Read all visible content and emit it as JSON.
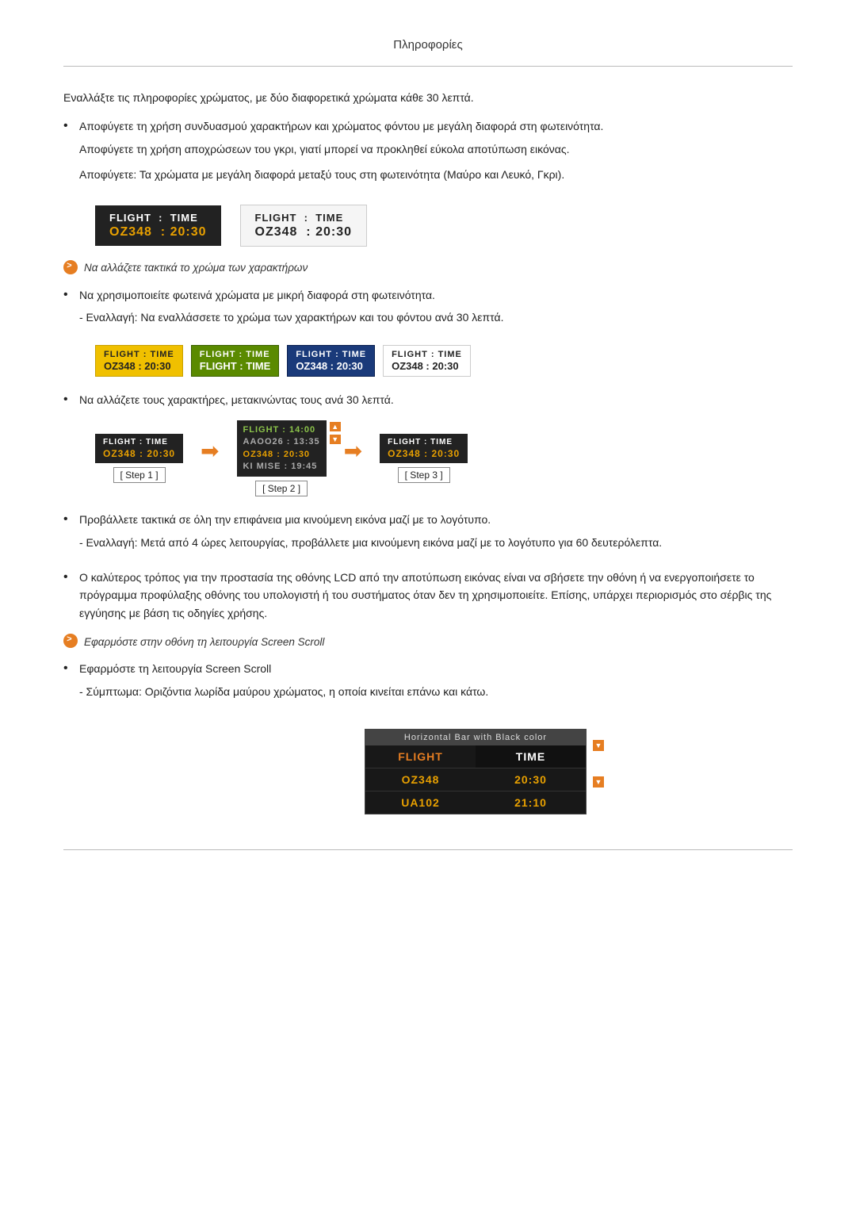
{
  "page": {
    "title": "Πληροφορίες",
    "intro": "Εναλλάξτε τις πληροφορίες χρώματος, με δύο διαφορετικά χρώματα κάθε 30 λεπτά.",
    "bullet1": {
      "text": "Αποφύγετε τη χρήση συνδυασμού χαρακτήρων και χρώματος φόντου με μεγάλη διαφορά στη φωτεινότητα.",
      "sub1": "Αποφύγετε τη χρήση αποχρώσεων του γκρι, γιατί μπορεί να προκληθεί εύκολα αποτύπωση εικόνας.",
      "sub2": "Αποφύγετε: Τα χρώματα με μεγάλη διαφορά μεταξύ τους στη φωτεινότητα (Μαύρο και Λευκό, Γκρι)."
    },
    "note1": "Να αλλάζετε τακτικά το χρώμα των χαρακτήρων",
    "bullet2": {
      "text": "Να χρησιμοποιείτε φωτεινά χρώματα με μικρή διαφορά στη φωτεινότητα.",
      "sub": "- Εναλλαγή: Να εναλλάσσετε το χρώμα των χαρακτήρων και του φόντου ανά 30 λεπτά."
    },
    "bullet3": {
      "text": "Να αλλάζετε τους χαρακτήρες, μετακινώντας τους ανά 30 λεπτά.",
      "step1": "[ Step 1 ]",
      "step2": "[ Step 2 ]",
      "step3": "[ Step 3 ]"
    },
    "bullet4": {
      "text": "Προβάλλετε τακτικά σε όλη την επιφάνεια μια κινούμενη εικόνα μαζί με το λογότυπο.",
      "sub": "- Εναλλαγή: Μετά από 4 ώρες λειτουργίας, προβάλλετε μια κινούμενη εικόνα μαζί με το λογότυπο για 60 δευτερόλεπτα."
    },
    "bullet5": {
      "text": "Ο καλύτερος τρόπος για την προστασία της οθόνης LCD από την αποτύπωση εικόνας είναι να σβήσετε την οθόνη ή να ενεργοποιήσετε το πρόγραμμα προφύλαξης οθόνης του υπολογιστή ή του συστήματος όταν δεν τη χρησιμοποιείτε. Επίσης, υπάρχει περιορισμός στο σέρβις της εγγύησης με βάση τις οδηγίες χρήσης."
    },
    "note2": "Εφαρμόστε στην οθόνη τη λειτουργία Screen Scroll",
    "bullet6": {
      "text": "Εφαρμόστε τη λειτουργία Screen Scroll",
      "sub": "- Σύμπτωμα: Οριζόντια λωρίδα μαύρου χρώματος, η οποία κινείται επάνω και κάτω."
    },
    "flight": {
      "header": "FLIGHT  :  TIME",
      "data": "OZ348   :  20:30"
    },
    "scroll_demo": {
      "header": "Horizontal Bar with Black color",
      "row1_label": "FLIGHT",
      "row1_value": "TIME",
      "row2_label": "OZ348",
      "row2_value": "20:30",
      "row3_label": "UA102",
      "row3_value": "21:10"
    }
  }
}
